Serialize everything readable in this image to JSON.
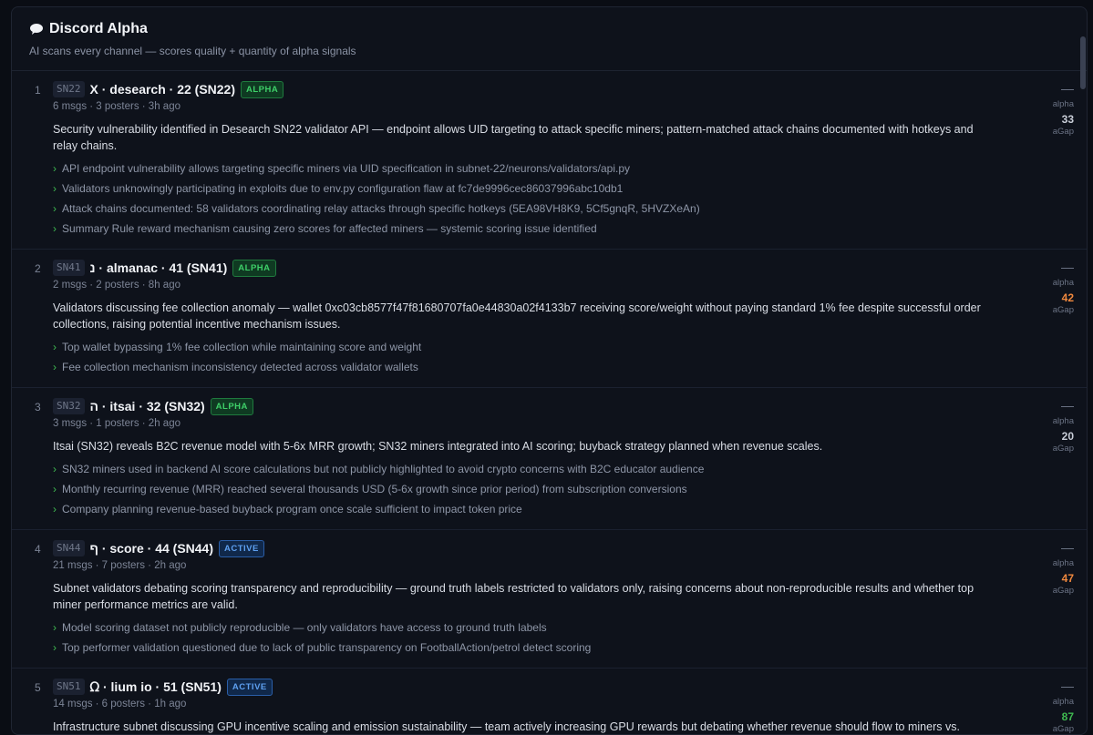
{
  "header": {
    "icon": "speech-bubble-icon",
    "title": "Discord Alpha",
    "subtitle": "AI scans every channel — scores quality + quantity of alpha signals"
  },
  "rows": [
    {
      "rank": "1",
      "tag": "SN22",
      "name": "X · desearch · 22 (SN22)",
      "badge": "ALPHA",
      "badge_type": "alpha",
      "meta": "6 msgs · 3 posters · 3h ago",
      "summary": "Security vulnerability identified in Desearch SN22 validator API — endpoint allows UID targeting to attack specific miners; pattern-matched attack chains documented with hotkeys and relay chains.",
      "bullets": [
        "API endpoint vulnerability allows targeting specific miners via UID specification in subnet-22/neurons/validators/api.py",
        "Validators unknowingly participating in exploits due to env.py configuration flaw at fc7de9996cec86037996abc10db1",
        "Attack chains documented: 58 validators coordinating relay attacks through specific hotkeys (5EA98VH8K9, 5Cf5gnqR, 5HVZXeAn)",
        "Summary Rule reward mechanism causing zero scores for affected miners — systemic scoring issue identified"
      ],
      "score": {
        "dash": "—",
        "label": "alpha",
        "value": "33",
        "sub": "aGap",
        "color": "#c9ced8"
      }
    },
    {
      "rank": "2",
      "tag": "SN41",
      "name": "נ · almanac · 41 (SN41)",
      "badge": "ALPHA",
      "badge_type": "alpha",
      "meta": "2 msgs · 2 posters · 8h ago",
      "summary": "Validators discussing fee collection anomaly — wallet 0xc03cb8577f47f81680707fa0e44830a02f4133b7 receiving score/weight without paying standard 1% fee despite successful order collections, raising potential incentive mechanism issues.",
      "bullets": [
        "Top wallet bypassing 1% fee collection while maintaining score and weight",
        "Fee collection mechanism inconsistency detected across validator wallets"
      ],
      "score": {
        "dash": "—",
        "label": "alpha",
        "value": "42",
        "sub": "aGap",
        "color": "#f0883e"
      }
    },
    {
      "rank": "3",
      "tag": "SN32",
      "name": "ה · itsai · 32 (SN32)",
      "badge": "ALPHA",
      "badge_type": "alpha",
      "meta": "3 msgs · 1 posters · 2h ago",
      "summary": "Itsai (SN32) reveals B2C revenue model with 5-6x MRR growth; SN32 miners integrated into AI scoring; buyback strategy planned when revenue scales.",
      "bullets": [
        "SN32 miners used in backend AI score calculations but not publicly highlighted to avoid crypto concerns with B2C educator audience",
        "Monthly recurring revenue (MRR) reached several thousands USD (5-6x growth since prior period) from subscription conversions",
        "Company planning revenue-based buyback program once scale sufficient to impact token price"
      ],
      "score": {
        "dash": "—",
        "label": "alpha",
        "value": "20",
        "sub": "aGap",
        "color": "#c9ced8"
      }
    },
    {
      "rank": "4",
      "tag": "SN44",
      "name": "ף · score · 44 (SN44)",
      "badge": "ACTIVE",
      "badge_type": "active",
      "meta": "21 msgs · 7 posters · 2h ago",
      "summary": "Subnet validators debating scoring transparency and reproducibility — ground truth labels restricted to validators only, raising concerns about non-reproducible results and whether top miner performance metrics are valid.",
      "bullets": [
        "Model scoring dataset not publicly reproducible — only validators have access to ground truth labels",
        "Top performer validation questioned due to lack of public transparency on FootballAction/petrol detect scoring"
      ],
      "score": {
        "dash": "—",
        "label": "alpha",
        "value": "47",
        "sub": "aGap",
        "color": "#f0883e"
      }
    },
    {
      "rank": "5",
      "tag": "SN51",
      "name": "ᘯ · lium io · 51 (SN51)",
      "badge": "ACTIVE",
      "badge_type": "active",
      "meta": "14 msgs · 6 posters · 1h ago",
      "summary": "Infrastructure subnet discussing GPU incentive scaling and emission sustainability — team actively increasing GPU rewards but debating whether revenue should flow to miners vs. capital reserves to",
      "bullets": [],
      "score": {
        "dash": "—",
        "label": "alpha",
        "value": "87",
        "sub": "aGap",
        "color": "#3fb950"
      }
    }
  ]
}
